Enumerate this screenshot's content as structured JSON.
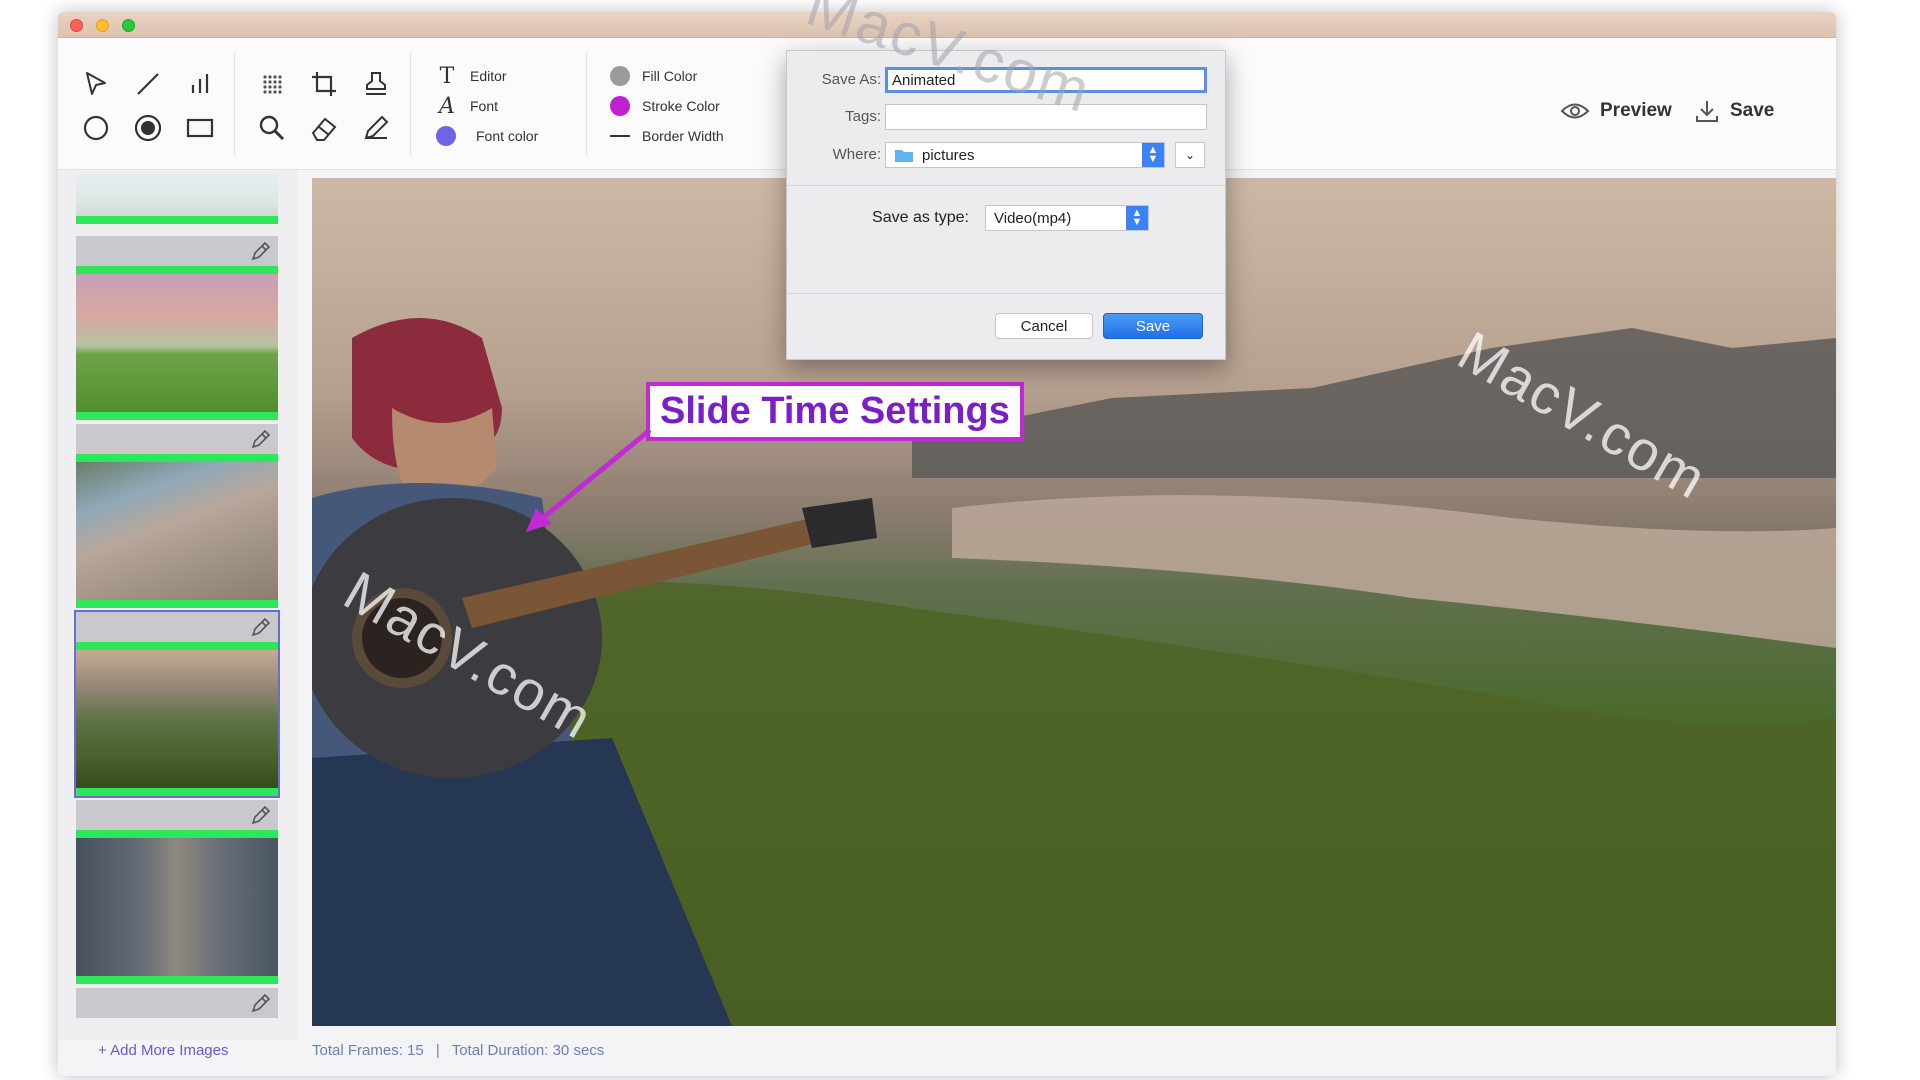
{
  "toolbar": {
    "text_tools": {
      "editor": "Editor",
      "font": "Font",
      "font_color": "Font color"
    },
    "style_tools": {
      "fill_color": "Fill Color",
      "stroke_color": "Stroke Color",
      "border_width": "Border Width"
    },
    "colors": {
      "fill": "#9b9b9b",
      "stroke": "#c020d0",
      "font_color": "#6f63e8"
    },
    "preview_label": "Preview",
    "save_label": "Save"
  },
  "dialog": {
    "save_as_label": "Save As:",
    "save_as_value": "Animated",
    "tags_label": "Tags:",
    "tags_value": "",
    "where_label": "Where:",
    "where_value": "pictures",
    "type_label": "Save as type:",
    "type_value": "Video(mp4)",
    "cancel_label": "Cancel",
    "save_label": "Save"
  },
  "canvas": {
    "annotation": "Slide Time Settings"
  },
  "sidebar": {
    "add_more_label": "+ Add More Images",
    "thumbnail_count": 6,
    "selected_index": 3
  },
  "status": {
    "total_frames": "Total Frames: 15",
    "separator": "|",
    "total_duration": "Total Duration: 30 secs"
  },
  "watermark": "MacV.com",
  "accent_colors": {
    "progress_bar": "#2ee65a",
    "selection": "#6b6bd6",
    "dialog_button": "#1f6fe6"
  }
}
